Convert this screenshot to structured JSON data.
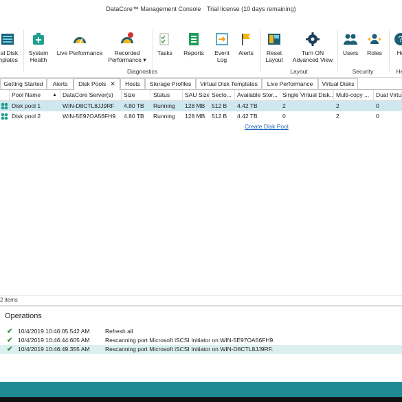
{
  "titlebar": {
    "app": "DataCore™ Management Console",
    "license": "Trial license (10 days remaining)"
  },
  "ribbon": {
    "buttons": [
      {
        "label1": "ual Disk",
        "label2": "mplates",
        "icon": "virtual-disk-templates-icon"
      },
      {
        "label1": "System",
        "label2": "Health",
        "icon": "system-health-icon"
      },
      {
        "label1": "Live Performance",
        "label2": "",
        "icon": "live-performance-icon"
      },
      {
        "label1": "Recorded",
        "label2": "Performance ▾",
        "icon": "recorded-performance-icon"
      },
      {
        "label1": "Tasks",
        "label2": "",
        "icon": "tasks-icon"
      },
      {
        "label1": "Reports",
        "label2": "",
        "icon": "reports-icon"
      },
      {
        "label1": "Event",
        "label2": "Log",
        "icon": "event-log-icon"
      },
      {
        "label1": "Alerts",
        "label2": "",
        "icon": "alerts-icon"
      },
      {
        "label1": "Reset",
        "label2": "Layout",
        "icon": "reset-layout-icon"
      },
      {
        "label1": "Turn ON",
        "label2": "Advanced View",
        "icon": "advanced-view-icon"
      },
      {
        "label1": "Users",
        "label2": "",
        "icon": "users-icon"
      },
      {
        "label1": "Roles",
        "label2": "",
        "icon": "roles-icon"
      },
      {
        "label1": "He",
        "label2": "",
        "icon": "help-icon"
      }
    ],
    "groups": [
      "Diagnostics",
      "Layout",
      "Security",
      "He"
    ]
  },
  "tabs": [
    "Getting Started",
    "Alerts",
    "Disk Pools",
    "Hosts",
    "Storage Profiles",
    "Virtual Disk Templates",
    "Live Performance",
    "Virtual Disks"
  ],
  "active_tab": "Disk Pools",
  "grid": {
    "columns": [
      "Pool Name",
      "DataCore Server(s)",
      "Size",
      "Status",
      "SAU Size",
      "Secto...",
      "Available Stor...",
      "Single Virtual Disk...",
      "Multi-copy ...",
      "Dual Virtua"
    ],
    "rows": [
      [
        "Disk pool 1",
        "WIN-D8CTL8JJ9RF",
        "4.80 TB",
        "Running",
        "128 MB",
        "512 B",
        "4.42 TB",
        "2",
        "2",
        "0"
      ],
      [
        "Disk pool 2",
        "WIN-5E97OA56FH9",
        "4.80 TB",
        "Running",
        "128 MB",
        "512 B",
        "4.42 TB",
        "0",
        "2",
        "0"
      ]
    ],
    "create_link": "Create Disk Pool",
    "count": "2 items"
  },
  "operations": {
    "title": "Operations",
    "items": [
      {
        "date": "10/4/2019 10:46:05.542 AM",
        "message": "Refresh all"
      },
      {
        "date": "10/4/2019 10:46:44.605 AM",
        "message": "Rescanning port Microsoft iSCSI Initiator on WIN-5E97OA56FH9."
      },
      {
        "date": "10/4/2019 10:46:49.355 AM",
        "message": "Rescanning port Microsoft iSCSI Initiator on WIN-D8CTL8JJ9RF."
      }
    ]
  },
  "colors": {
    "accent": "#1f8a93",
    "selected_row": "#cfe8ef",
    "link": "#1a63b8",
    "check": "#2e8b3a"
  }
}
